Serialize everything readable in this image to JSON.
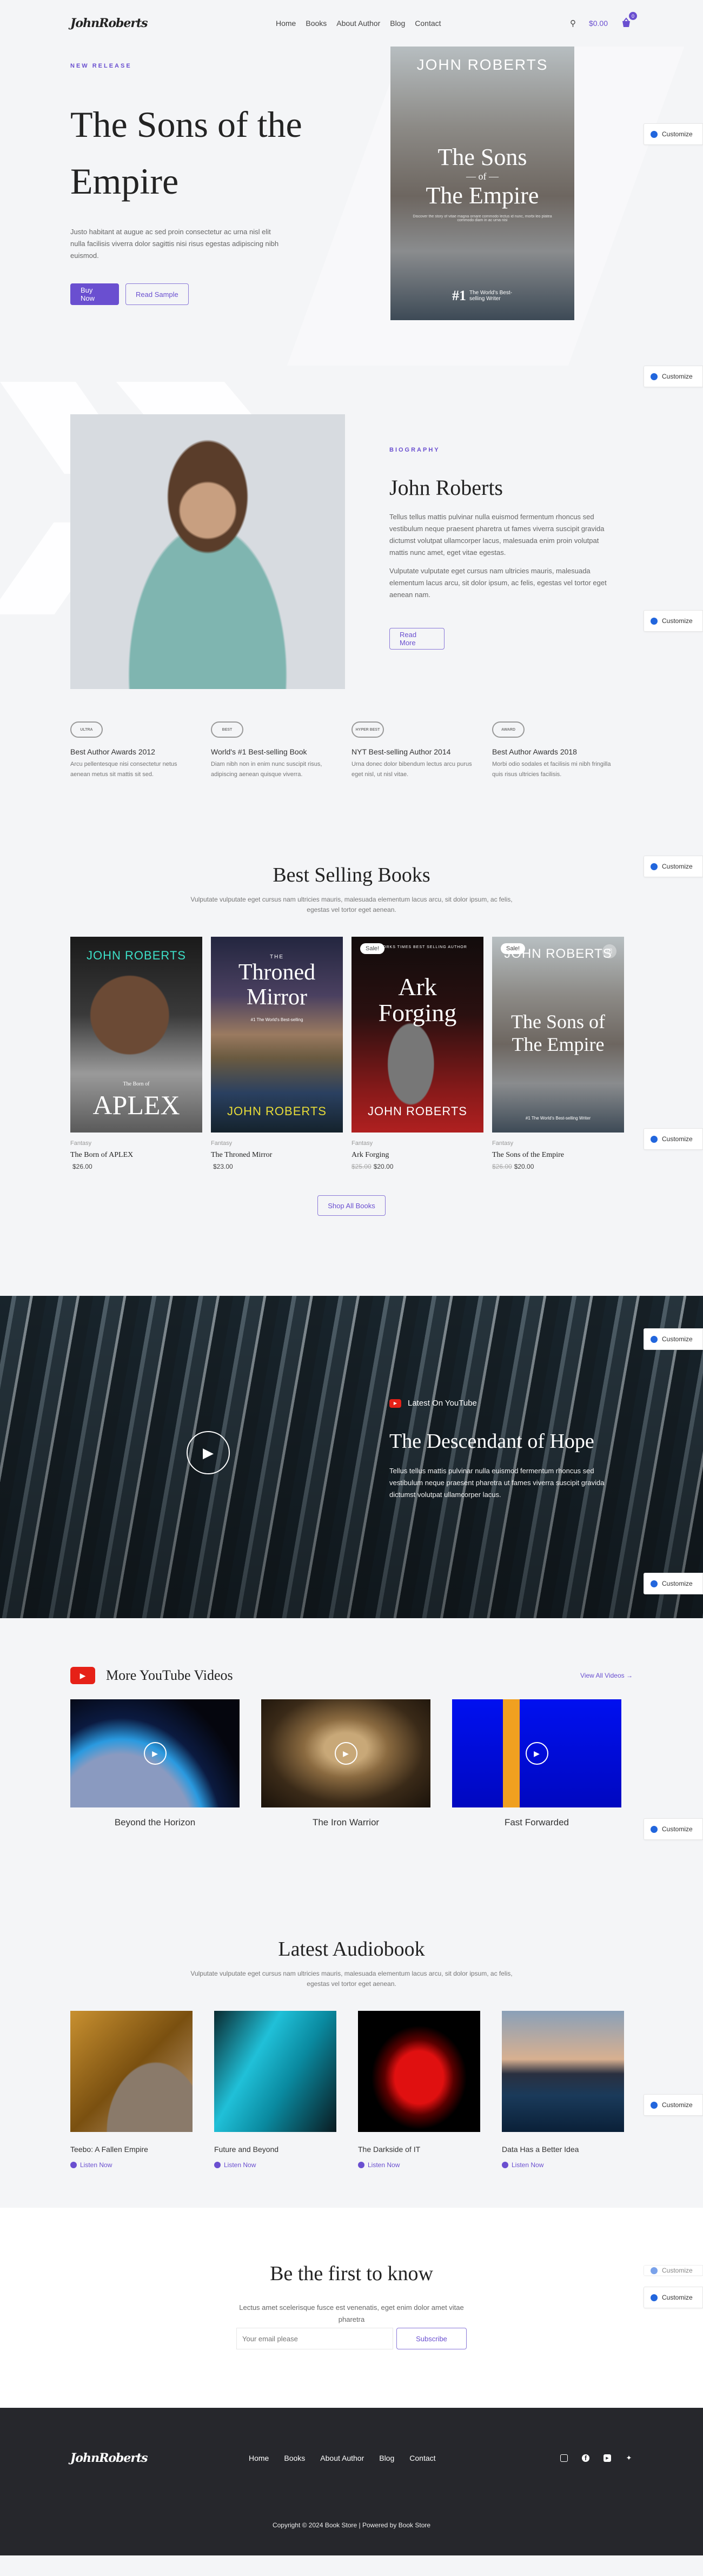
{
  "header": {
    "logo": "JohnRoberts",
    "nav": [
      "Home",
      "Books",
      "About Author",
      "Blog",
      "Contact"
    ],
    "cart_total": "$0.00",
    "cart_count": "0"
  },
  "customize_label": "Customize",
  "hero": {
    "eyebrow": "NEW RELEASE",
    "title": "The Sons of the Empire",
    "description": "Justo habitant at augue ac sed proin consectetur ac urna nisl elit nulla facilisis viverra dolor sagittis nisi risus egestas adipiscing nibh euismod.",
    "buy_label": "Buy Now",
    "sample_label": "Read Sample",
    "cover": {
      "author": "JOHN ROBERTS",
      "line1": "The Sons",
      "of": "— of —",
      "line2": "The Empire",
      "blurb": "Discover the story of vitae magna ornare commodo lectus id nunc, morbi leo platea commodo diam in ac urna nisi",
      "rank": "#1",
      "rank_text": "The World's Best-selling Writer"
    }
  },
  "bio": {
    "eyebrow": "BIOGRAPHY",
    "name": "John Roberts",
    "p1": "Tellus tellus mattis pulvinar nulla euismod fermentum rhoncus sed vestibulum neque praesent pharetra ut fames viverra suscipit gravida dictumst volutpat ullamcorper lacus, malesuada enim proin volutpat mattis nunc amet, eget vitae egestas.",
    "p2": "Vulputate vulputate eget cursus nam ultricies mauris, malesuada elementum lacus arcu, sit dolor ipsum, ac felis, egestas vel tortor eget aenean nam.",
    "read_more": "Read More"
  },
  "awards": [
    {
      "emblem": "ULTRA",
      "title": "Best Author Awards 2012",
      "text": "Arcu pellentesque nisi consectetur netus aenean metus sit mattis sit sed."
    },
    {
      "emblem": "BEST",
      "title": "World's #1 Best-selling Book",
      "text": "Diam nibh non in enim nunc suscipit risus, adipiscing aenean quisque viverra."
    },
    {
      "emblem": "HYPER BEST",
      "title": "NYT Best-selling Author 2014",
      "text": "Urna donec dolor bibendum lectus arcu purus eget nisl, ut nisl vitae."
    },
    {
      "emblem": "AWARD",
      "title": "Best Author Awards 2018",
      "text": "Morbi odio sodales et facilisis mi nibh fringilla quis risus ultricies facilisis."
    }
  ],
  "best_selling": {
    "title": "Best Selling Books",
    "subtitle": "Vulputate vulputate eget cursus nam ultricies mauris, malesuada elementum lacus arcu, sit dolor ipsum, ac felis, egestas vel tortor eget aenean.",
    "books": [
      {
        "category": "Fantasy",
        "title": "The Born of APLEX",
        "price": "$26.00",
        "old_price": "",
        "sale": "",
        "cover_top": "JOHN ROBERTS",
        "cover_main": "APLEX",
        "cover_small": "The Born of",
        "cover_bottom": ""
      },
      {
        "category": "Fantasy",
        "title": "The Throned Mirror",
        "price": "$23.00",
        "old_price": "",
        "sale": "",
        "cover_top": "THE",
        "cover_main": "Throned Mirror",
        "cover_small": "#1 The World's Best-selling",
        "cover_bottom": "JOHN ROBERTS"
      },
      {
        "category": "Fantasy",
        "title": "Ark Forging",
        "price": "$20.00",
        "old_price": "$25.00",
        "sale": "Sale!",
        "cover_top": "NEW YORKS TIMES BEST SELLING AUTHOR",
        "cover_main": "Ark Forging",
        "cover_small": "",
        "cover_bottom": "JOHN ROBERTS"
      },
      {
        "category": "Fantasy",
        "title": "The Sons of the Empire",
        "price": "$20.00",
        "old_price": "$26.00",
        "sale": "Sale!",
        "cover_top": "JOHN ROBERTS",
        "cover_main": "The Sons of The Empire",
        "cover_small": "#1 The World's Best-selling Writer",
        "cover_bottom": ""
      }
    ],
    "shop_all": "Shop All Books"
  },
  "youtube_feature": {
    "label": "Latest On YouTube",
    "title": "The Descendant of Hope",
    "text": "Tellus tellus mattis pulvinar nulla euismod fermentum rhoncus sed vestibulum neque praesent pharetra ut fames viverra suscipit gravida dictumst volutpat ullamcorper lacus."
  },
  "more_videos": {
    "title": "More YouTube Videos",
    "view_all": "View All Videos →",
    "videos": [
      {
        "title": "Beyond the Horizon"
      },
      {
        "title": "The Iron Warrior"
      },
      {
        "title": "Fast Forwarded"
      }
    ]
  },
  "audiobooks": {
    "title": "Latest Audiobook",
    "subtitle": "Vulputate vulputate eget cursus nam ultricies mauris, malesuada elementum lacus arcu, sit dolor ipsum, ac felis, egestas vel tortor eget aenean.",
    "listen_label": "Listen Now",
    "items": [
      {
        "title": "Teebo: A Fallen Empire"
      },
      {
        "title": "Future and Beyond"
      },
      {
        "title": "The Darkside of IT"
      },
      {
        "title": "Data Has a Better Idea"
      }
    ]
  },
  "subscribe": {
    "title": "Be the first to know",
    "text": "Lectus amet scelerisque fusce est venenatis, eget enim dolor amet vitae pharetra",
    "placeholder": "Your email please",
    "button": "Subscribe"
  },
  "footer": {
    "logo": "JohnRoberts",
    "nav": [
      "Home",
      "Books",
      "About Author",
      "Blog",
      "Contact"
    ],
    "copyright": "Copyright © 2024 Book Store | Powered by Book Store"
  },
  "colors": {
    "accent": "#6a4fd0",
    "youtube": "#e62117",
    "footer_bg": "#26272c",
    "page_bg": "#f4f5f7"
  }
}
